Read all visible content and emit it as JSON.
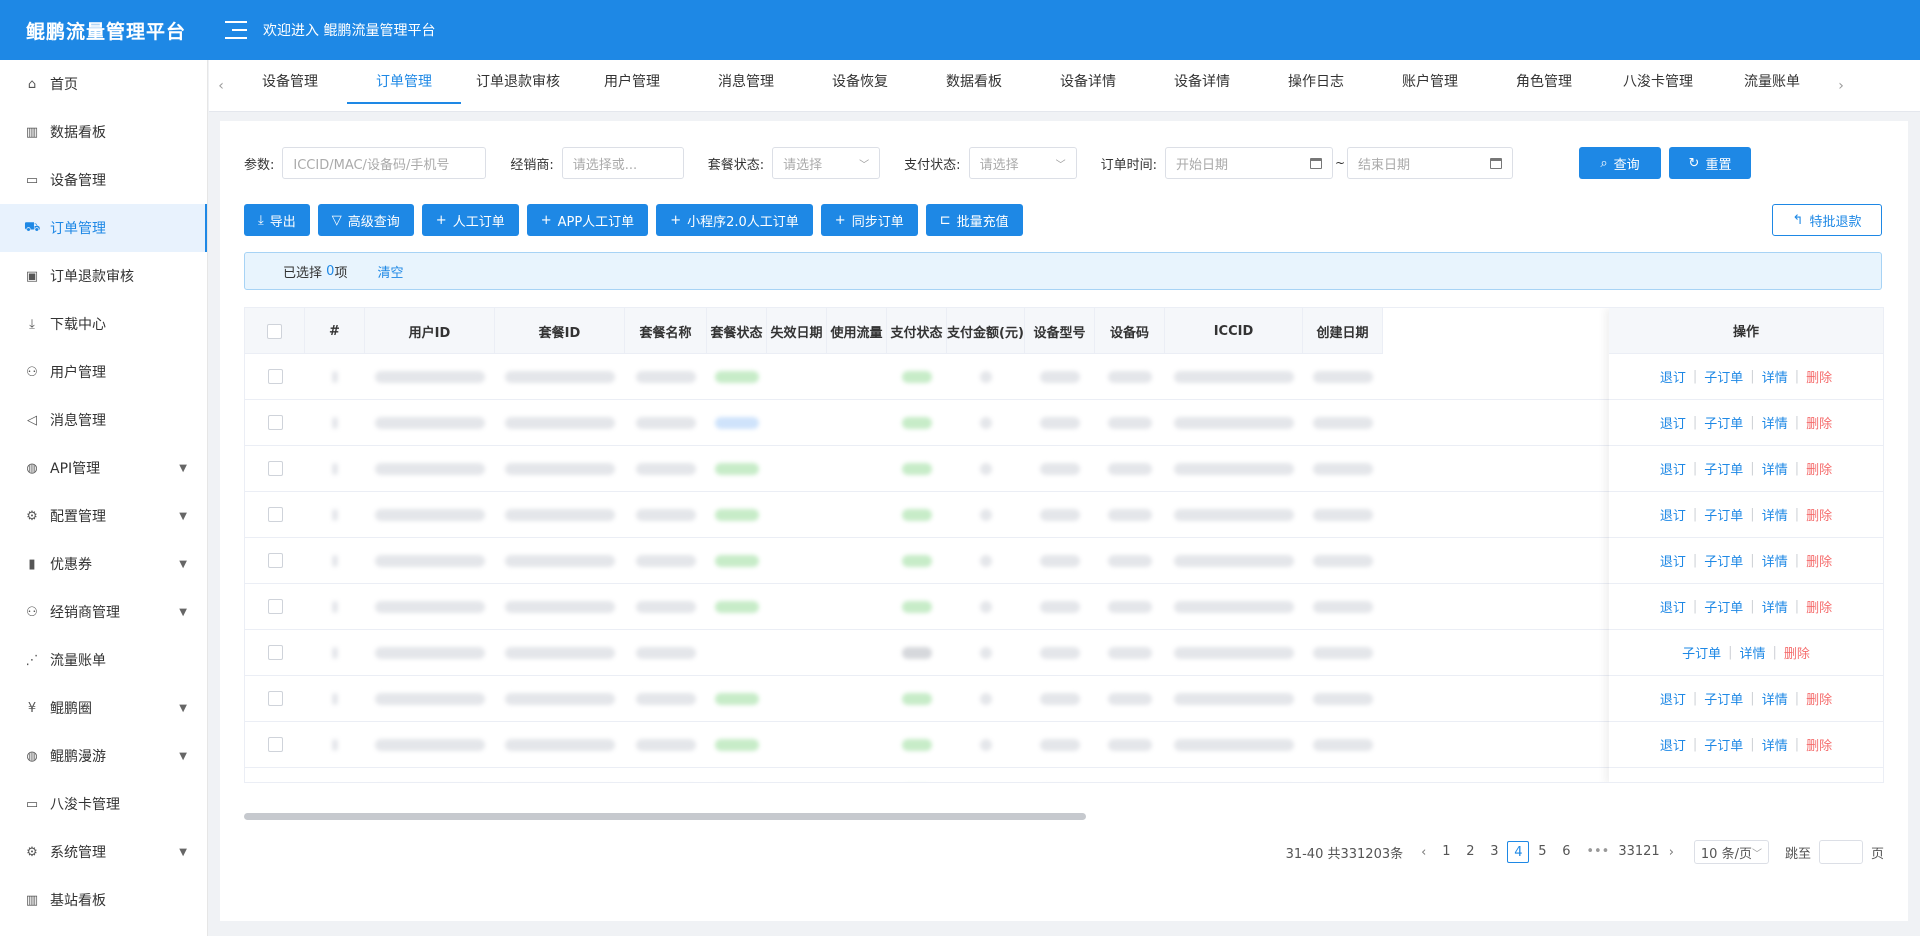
{
  "header": {
    "brand": "鲲鹏流量管理平台",
    "welcome": "欢迎进入 鲲鹏流量管理平台"
  },
  "sidebar": {
    "items": [
      {
        "label": "首页",
        "icon": "home-icon",
        "glyph": "⌂",
        "expandable": false,
        "active": false
      },
      {
        "label": "数据看板",
        "icon": "bar-chart-icon",
        "glyph": "▥",
        "expandable": false,
        "active": false
      },
      {
        "label": "设备管理",
        "icon": "monitor-icon",
        "glyph": "▭",
        "expandable": false,
        "active": false
      },
      {
        "label": "订单管理",
        "icon": "cart-icon",
        "glyph": "⛟",
        "expandable": false,
        "active": true
      },
      {
        "label": "订单退款审核",
        "icon": "audit-icon",
        "glyph": "▣",
        "expandable": false,
        "active": false
      },
      {
        "label": "下载中心",
        "icon": "download-icon",
        "glyph": "⤓",
        "expandable": false,
        "active": false
      },
      {
        "label": "用户管理",
        "icon": "user-icon",
        "glyph": "⚇",
        "expandable": false,
        "active": false
      },
      {
        "label": "消息管理",
        "icon": "megaphone-icon",
        "glyph": "◁",
        "expandable": false,
        "active": false
      },
      {
        "label": "API管理",
        "icon": "globe-icon",
        "glyph": "◍",
        "expandable": true,
        "active": false
      },
      {
        "label": "配置管理",
        "icon": "gear-icon",
        "glyph": "⚙",
        "expandable": true,
        "active": false
      },
      {
        "label": "优惠券",
        "icon": "barcode-icon",
        "glyph": "▮",
        "expandable": true,
        "active": false
      },
      {
        "label": "经销商管理",
        "icon": "dealer-icon",
        "glyph": "⚇",
        "expandable": true,
        "active": false
      },
      {
        "label": "流量账单",
        "icon": "chart-line-icon",
        "glyph": "⋰",
        "expandable": false,
        "active": false
      },
      {
        "label": "鲲鹏圈",
        "icon": "yen-icon",
        "glyph": "¥",
        "expandable": true,
        "active": false
      },
      {
        "label": "鲲鹏漫游",
        "icon": "globe-icon",
        "glyph": "◍",
        "expandable": true,
        "active": false
      },
      {
        "label": "八浚卡管理",
        "icon": "monitor-icon",
        "glyph": "▭",
        "expandable": false,
        "active": false
      },
      {
        "label": "系统管理",
        "icon": "gear-icon",
        "glyph": "⚙",
        "expandable": true,
        "active": false
      },
      {
        "label": "基站看板",
        "icon": "bar-chart-icon",
        "glyph": "▥",
        "expandable": false,
        "active": false
      }
    ]
  },
  "tabs": {
    "items": [
      "设备管理",
      "订单管理",
      "订单退款审核",
      "用户管理",
      "消息管理",
      "设备恢复",
      "数据看板",
      "设备详情",
      "设备详情",
      "操作日志",
      "账户管理",
      "角色管理",
      "八浚卡管理",
      "流量账单"
    ],
    "active_index": 1
  },
  "filters": {
    "param_label": "参数:",
    "param_placeholder": "ICCID/MAC/设备码/手机号",
    "dealer_label": "经销商:",
    "dealer_placeholder": "请选择或...",
    "package_status_label": "套餐状态:",
    "package_status_placeholder": "请选择",
    "pay_status_label": "支付状态:",
    "pay_status_placeholder": "请选择",
    "order_time_label": "订单时间:",
    "start_placeholder": "开始日期",
    "range_sep": "~",
    "end_placeholder": "结束日期",
    "search_label": "查询",
    "reset_label": "重置"
  },
  "toolbar": {
    "buttons": [
      {
        "label": "导出",
        "icon": "export-icon",
        "glyph": "⤓"
      },
      {
        "label": "高级查询",
        "icon": "filter-icon",
        "glyph": "▽"
      },
      {
        "label": "人工订单",
        "icon": "plus-icon",
        "glyph": "+"
      },
      {
        "label": "APP人工订单",
        "icon": "plus-icon",
        "glyph": "+"
      },
      {
        "label": "小程序2.0人工订单",
        "icon": "plus-icon",
        "glyph": "+"
      },
      {
        "label": "同步订单",
        "icon": "plus-icon",
        "glyph": "+"
      },
      {
        "label": "批量充值",
        "icon": "recharge-icon",
        "glyph": "⊏"
      }
    ],
    "special_refund_label": "特批退款"
  },
  "selection": {
    "prefix": "已选择",
    "count": "0",
    "suffix": "项",
    "clear_label": "清空"
  },
  "table": {
    "columns": [
      "",
      "#",
      "用户ID",
      "套餐ID",
      "套餐名称",
      "套餐状态",
      "失效日期",
      "使用流量",
      "支付状态",
      "支付金额(元)",
      "设备型号",
      "设备码",
      "ICCID",
      "创建日期"
    ],
    "ops_header": "操作",
    "op_labels": {
      "refund": "退订",
      "suborder": "子订单",
      "detail": "详情",
      "delete": "删除"
    },
    "rows": [
      {
        "status": "green",
        "pay": "green",
        "actions": [
          "refund",
          "suborder",
          "detail",
          "delete"
        ]
      },
      {
        "status": "blue",
        "pay": "green",
        "actions": [
          "refund",
          "suborder",
          "detail",
          "delete"
        ]
      },
      {
        "status": "green",
        "pay": "green",
        "actions": [
          "refund",
          "suborder",
          "detail",
          "delete"
        ]
      },
      {
        "status": "green",
        "pay": "green",
        "actions": [
          "refund",
          "suborder",
          "detail",
          "delete"
        ]
      },
      {
        "status": "green",
        "pay": "green",
        "actions": [
          "refund",
          "suborder",
          "detail",
          "delete"
        ]
      },
      {
        "status": "green",
        "pay": "green",
        "actions": [
          "refund",
          "suborder",
          "detail",
          "delete"
        ]
      },
      {
        "status": "none",
        "pay": "gray",
        "actions": [
          "suborder",
          "detail",
          "delete"
        ]
      },
      {
        "status": "green",
        "pay": "green",
        "actions": [
          "refund",
          "suborder",
          "detail",
          "delete"
        ]
      },
      {
        "status": "green",
        "pay": "green",
        "actions": [
          "refund",
          "suborder",
          "detail",
          "delete"
        ]
      },
      {
        "status": "blue",
        "pay": "green",
        "actions": [
          "refund",
          "suborder",
          "detail",
          "delete"
        ]
      }
    ]
  },
  "pagination": {
    "summary": "31-40 共331203条",
    "pages": [
      "1",
      "2",
      "3",
      "4",
      "5",
      "6"
    ],
    "current": "4",
    "ellipsis": "•••",
    "last": "33121",
    "page_size": "10 条/页",
    "goto_label": "跳至",
    "page_suffix": "页"
  }
}
